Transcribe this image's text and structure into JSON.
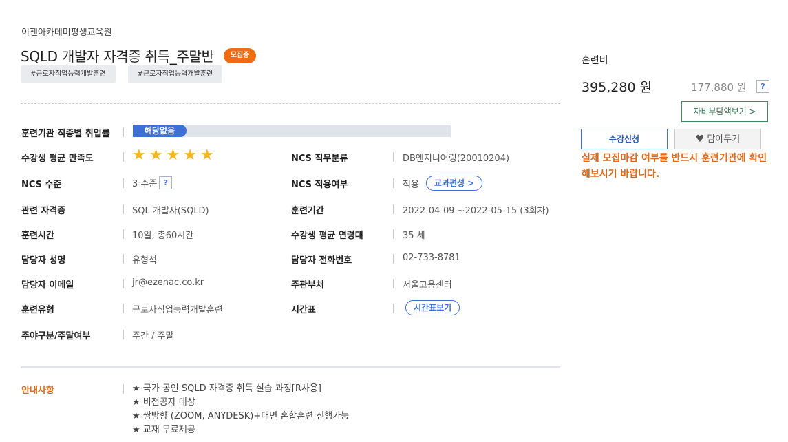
{
  "org": "이젠아카데미평생교육원",
  "course": {
    "title": "SQLD 개발자 자격증 취득_주말반",
    "status_badge": "모집중",
    "tags": [
      "#근로자직업능력개발훈련",
      "#근로자직업능력개발훈련"
    ]
  },
  "info": {
    "employment": {
      "label": "훈련기관 직종별 취업률",
      "bar_text": "해당없음"
    },
    "satisfaction": {
      "label": "수강생 평균 만족도",
      "stars": 5
    },
    "ncs_job": {
      "label": "NCS 직무분류",
      "value": "DB엔지니어링(20010204)"
    },
    "ncs_level": {
      "label": "NCS 수준",
      "value": "3 수준",
      "help": "?"
    },
    "ncs_apply": {
      "label": "NCS 적용여부",
      "value": "적용",
      "button": "교과편성 >"
    },
    "cert": {
      "label": "관련 자격증",
      "value": "SQL 개발자(SQLD)"
    },
    "period": {
      "label": "훈련기간",
      "value": "2022-04-09 ~2022-05-15 (3회차)"
    },
    "hours": {
      "label": "훈련시간",
      "value": "10일, 총60시간"
    },
    "age": {
      "label": "수강생 평균 연령대",
      "value": "35 세"
    },
    "manager": {
      "label": "담당자 성명",
      "value": "유형석"
    },
    "phone": {
      "label": "담당자 전화번호",
      "value": "02-733-8781"
    },
    "email": {
      "label": "담당자 이메일",
      "value": "jr@ezenac.co.kr"
    },
    "dept": {
      "label": "주관부처",
      "value": "서울고용센터"
    },
    "type": {
      "label": "훈련유형",
      "value": "근로자직업능력개발훈련"
    },
    "timetable": {
      "label": "시간표",
      "button": "시간표보기"
    },
    "daynight": {
      "label": "주야구분/주말여부",
      "value": "주간 / 주말"
    }
  },
  "notice": {
    "label": "안내사항",
    "items": [
      "★ 국가 공인 SQLD 자격증 취득 실습 과정[R사용]",
      "★ 비전공자 대상",
      "★ 쌍방향 (ZOOM, ANYDESK)+대면 혼합훈련 진행가능",
      "★ 교재 무료제공"
    ]
  },
  "sidebar": {
    "fee_label": "훈련비",
    "fee_main": "395,280 원",
    "fee_sub": "177,880 원",
    "fee_help": "?",
    "self_pay_button": "자비부담액보기 >",
    "apply_button": "수강신청",
    "wish_button": "담아두기",
    "warning": "실제 모집마감 여부를 반드시 훈련기관에 확인해보시기 바랍니다."
  }
}
